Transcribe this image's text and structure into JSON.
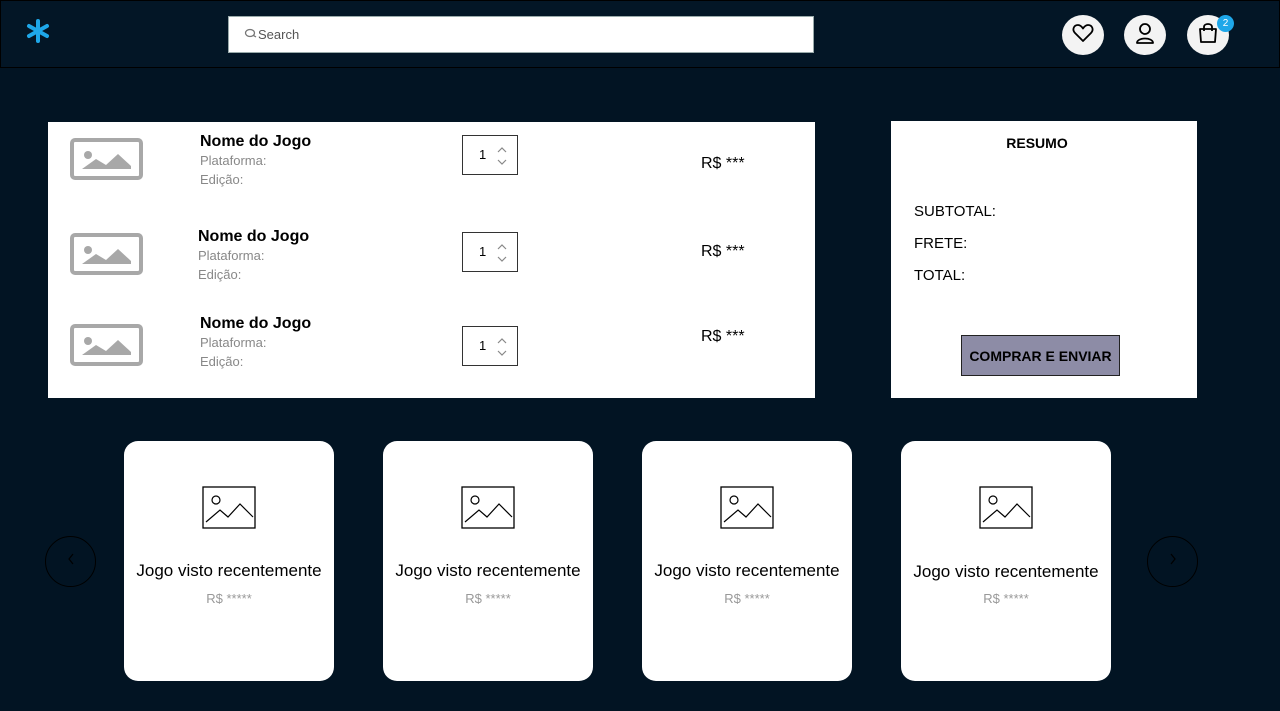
{
  "header": {
    "logo_icon": "asterisk-logo",
    "search": {
      "placeholder": "Search",
      "value": ""
    },
    "icons": [
      "heart-icon",
      "user-icon",
      "shopping-bag-icon"
    ],
    "cart_count": "2",
    "colors": {
      "accent": "#1ea7e9",
      "background": "#021423"
    }
  },
  "cart": {
    "items": [
      {
        "name": "Nome do Jogo",
        "platform": "Plataforma:",
        "edition": "Edição:",
        "quantity": "1",
        "price": "R$ ***"
      },
      {
        "name": "Nome do Jogo",
        "platform": "Plataforma:",
        "edition": "Edição:",
        "quantity": "1",
        "price": "R$ ***"
      },
      {
        "name": "Nome do Jogo",
        "platform": "Plataforma:",
        "edition": "Edição:",
        "quantity": "1",
        "price": "R$ ***"
      }
    ]
  },
  "summary": {
    "title": "RESUMO",
    "subtotal_label": "SUBTOTAL:",
    "shipping_label": "FRETE:",
    "total_label": "TOTAL:",
    "buy_button": "COMPRAR E ENVIAR",
    "button_color": "#8d8ca6"
  },
  "recent": {
    "cards": [
      {
        "title": "Jogo visto recentemente",
        "price": "R$ *****"
      },
      {
        "title": "Jogo visto recentemente",
        "price": "R$ *****"
      },
      {
        "title": "Jogo visto recentemente",
        "price": "R$ *****"
      },
      {
        "title": "Jogo visto recentemente",
        "price": "R$ *****"
      }
    ],
    "prev_icon": "chevron-left-icon",
    "next_icon": "chevron-right-icon"
  }
}
